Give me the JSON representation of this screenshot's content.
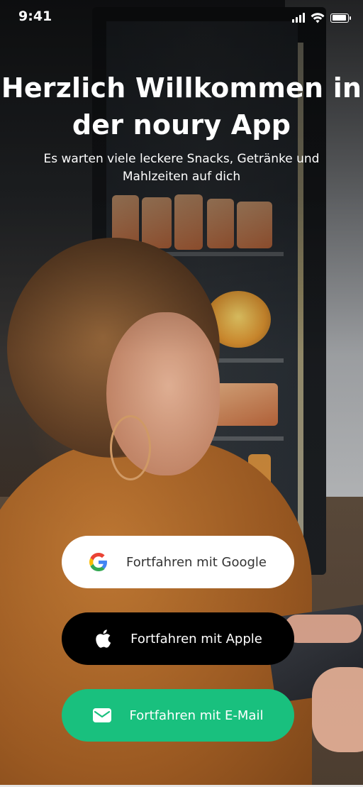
{
  "status_bar": {
    "time": "9:41"
  },
  "welcome": {
    "title_line1": "Herzlich Willkommen in",
    "title_line2": "der noury App",
    "subtitle": "Es warten viele leckere Snacks, Getränke und Mahlzeiten auf dich"
  },
  "buttons": {
    "google": {
      "label": "Fortfahren mit Google",
      "icon": "google-icon"
    },
    "apple": {
      "label": "Fortfahren mit Apple",
      "icon": "apple-icon"
    },
    "email": {
      "label": "Fortfahren mit E-Mail",
      "icon": "mail-icon"
    }
  },
  "colors": {
    "email_button": "#19c07e",
    "apple_button": "#000000",
    "google_button": "#ffffff"
  }
}
